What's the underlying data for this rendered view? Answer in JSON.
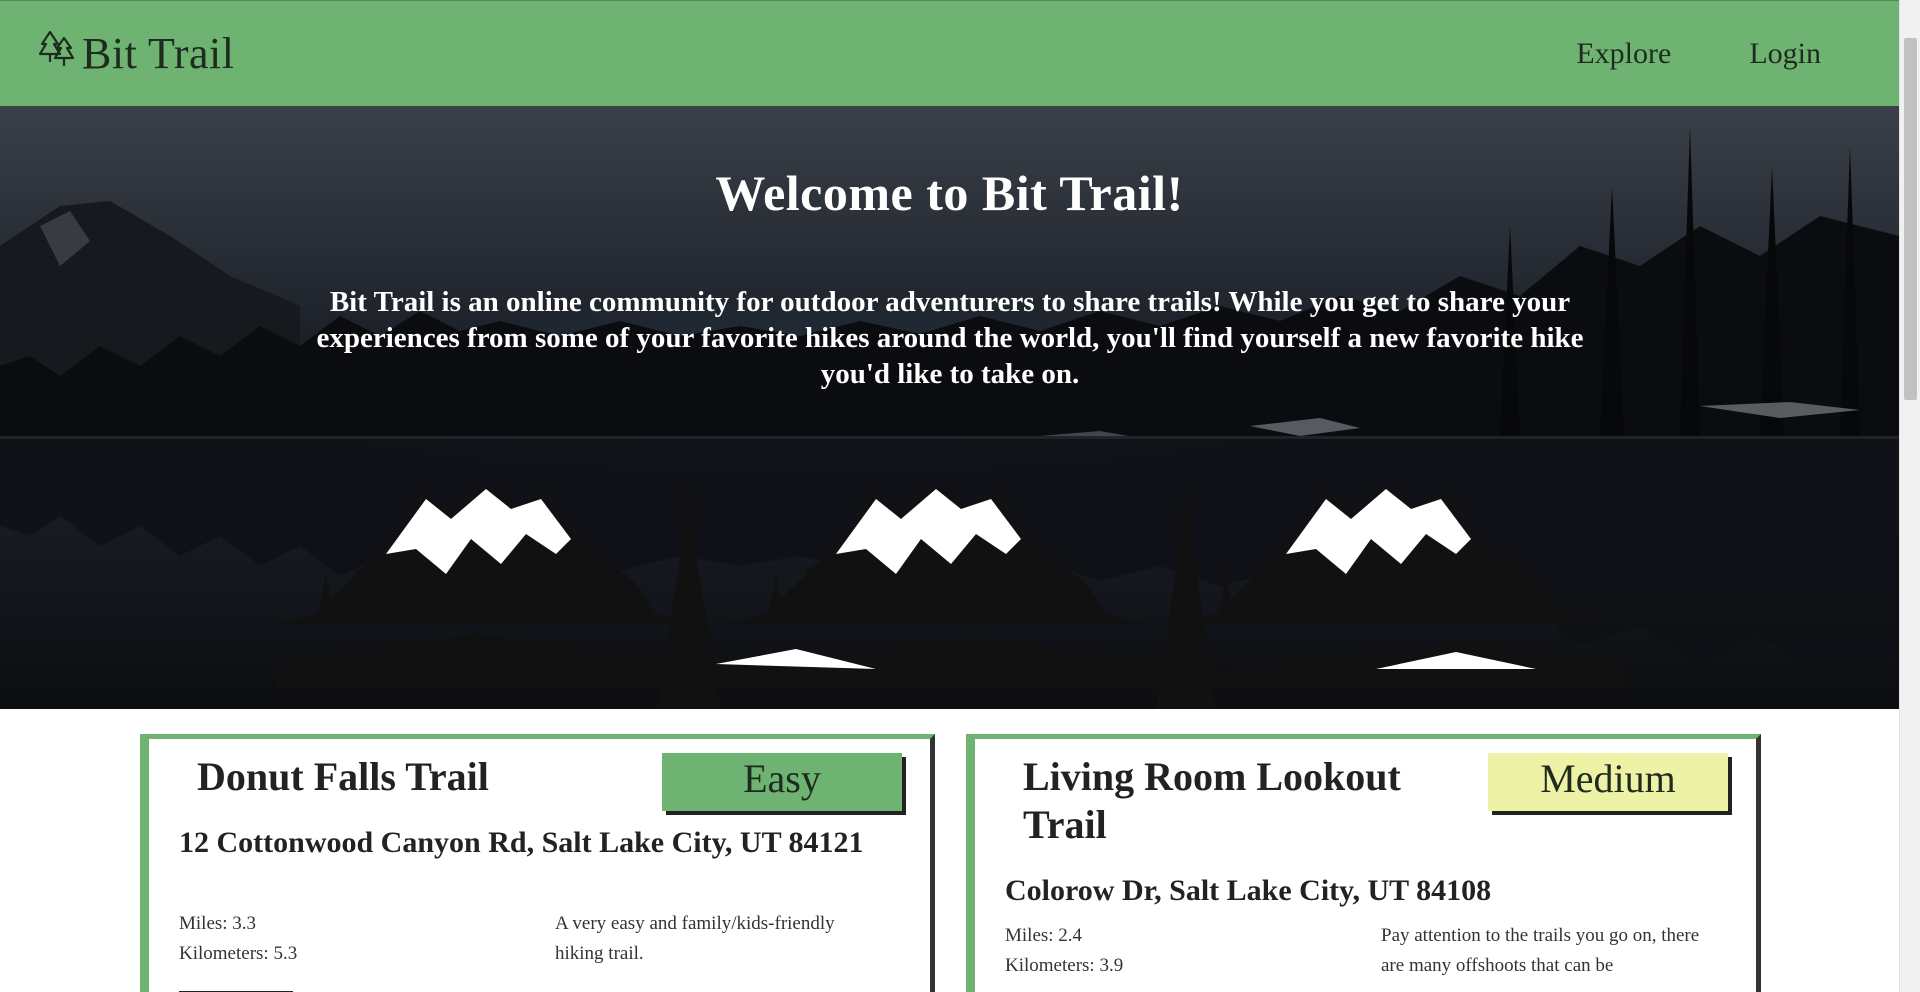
{
  "app": {
    "name": "Bit Trail"
  },
  "nav": {
    "items": [
      {
        "label": "Explore"
      },
      {
        "label": "Login"
      }
    ]
  },
  "hero": {
    "title": "Welcome to Bit Trail!",
    "text": "Bit Trail is an online community for outdoor adventurers to share trails! While you get to share your experiences from some of your favorite hikes around the world, you'll find yourself a new favorite hike you'd like to take on."
  },
  "trails": [
    {
      "name": "Donut Falls Trail",
      "difficulty": "Easy",
      "address": "12 Cottonwood Canyon Rd, Salt Lake City, UT 84121",
      "miles": "Miles: 3.3",
      "kilometers": "Kilometers: 5.3",
      "description": "A very easy and family/kids-friendly hiking trail."
    },
    {
      "name": "Living Room Lookout Trail",
      "difficulty": "Medium",
      "address": "Colorow Dr, Salt Lake City, UT 84108",
      "miles": "Miles: 2.4",
      "kilometers": "Kilometers: 3.9",
      "description": "Pay attention to the trails you go on, there are many offshoots that can be"
    }
  ],
  "colors": {
    "nav_green": "#6fb372",
    "easy": "#6fb372",
    "medium": "#eef2a6"
  },
  "icons": {
    "brand": "pine-trees-icon"
  }
}
